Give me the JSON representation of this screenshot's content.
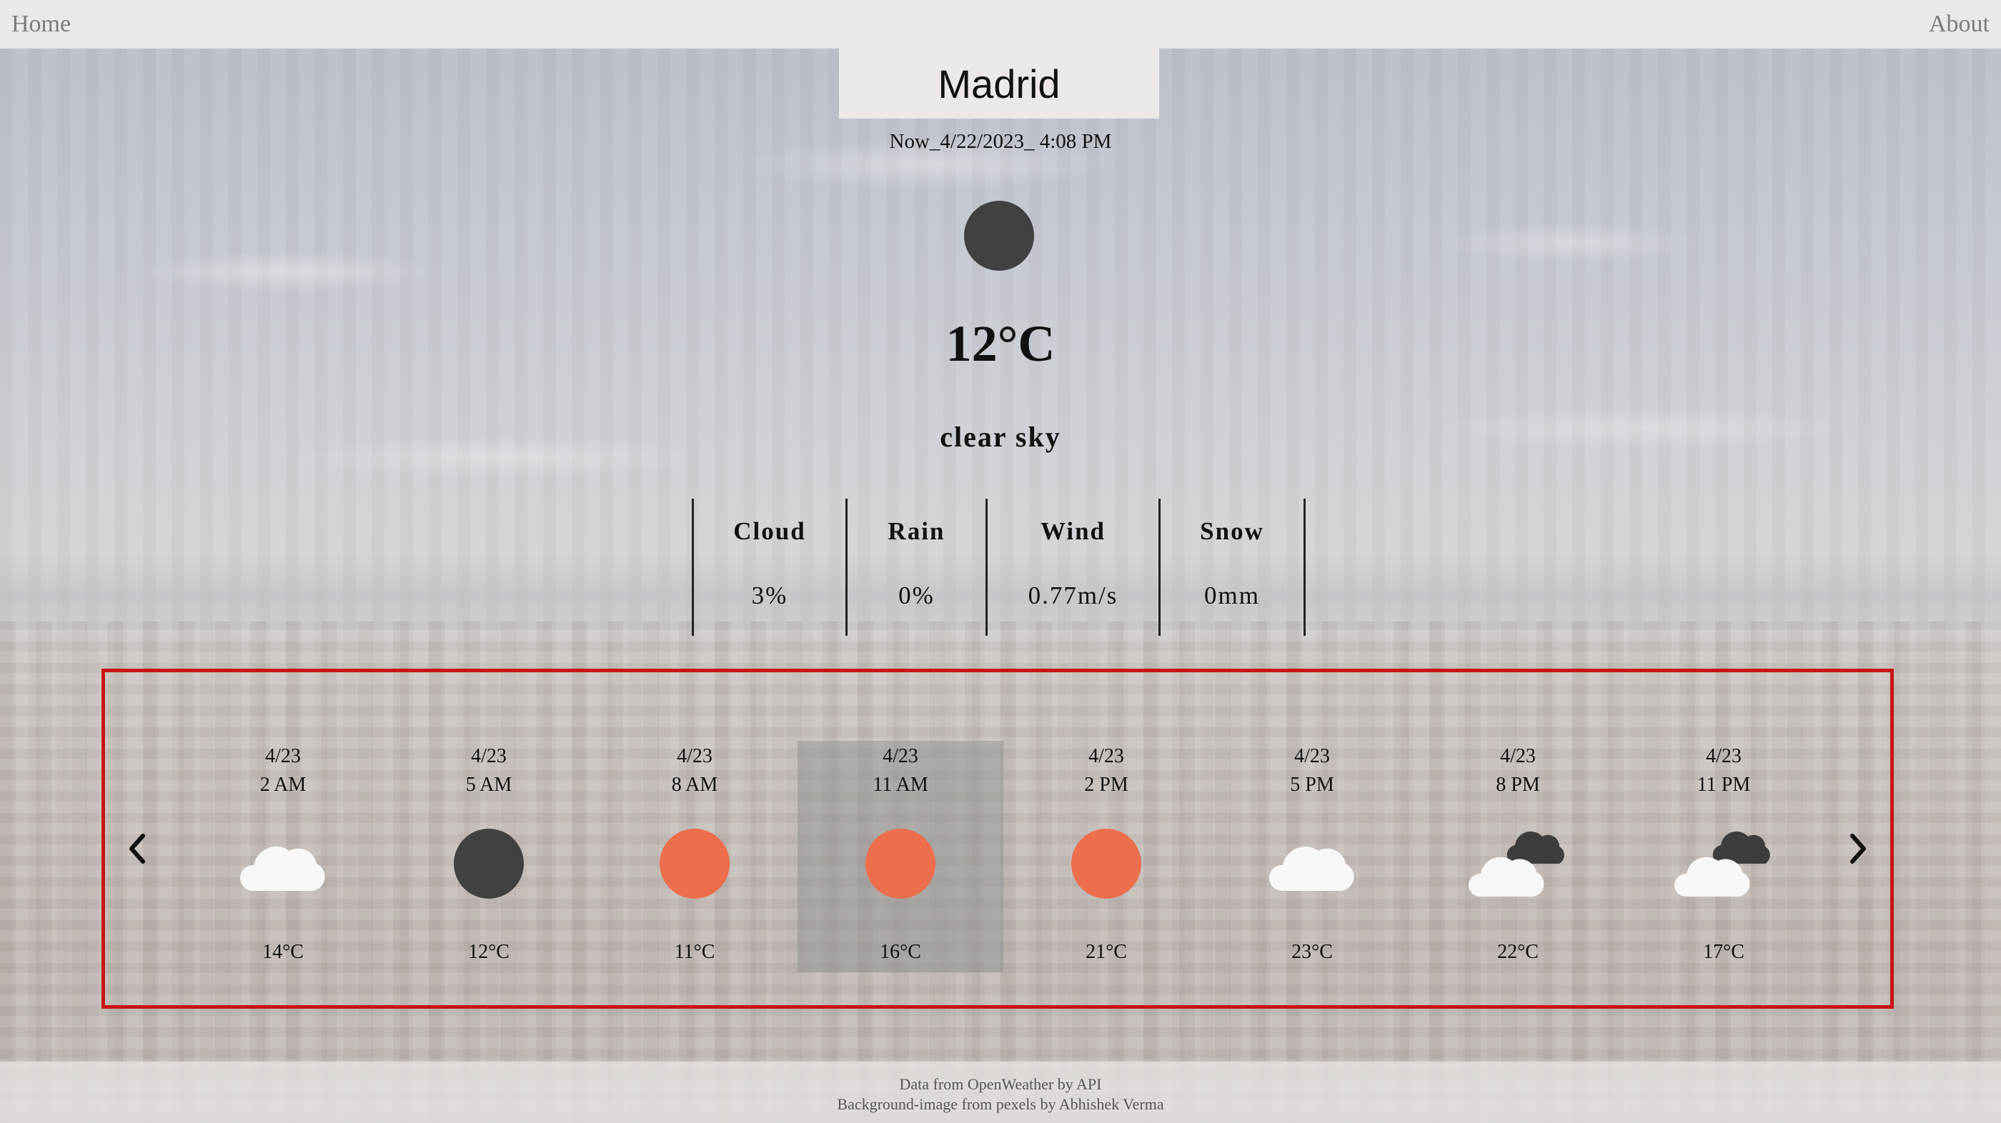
{
  "nav": {
    "home": "Home",
    "about": "About"
  },
  "current": {
    "city": "Madrid",
    "datetime": "Now_4/22/2023_ 4:08 PM",
    "icon": "moon-icon",
    "temperature": "12°C",
    "description": "clear sky"
  },
  "stats": [
    {
      "label": "Cloud",
      "value": "3%"
    },
    {
      "label": "Rain",
      "value": "0%"
    },
    {
      "label": "Wind",
      "value": "0.77m/s"
    },
    {
      "label": "Snow",
      "value": "0mm"
    }
  ],
  "forecast": [
    {
      "date": "4/23",
      "time": "2 AM",
      "icon": "cloud-icon",
      "temp": "14°C"
    },
    {
      "date": "4/23",
      "time": "5 AM",
      "icon": "moon-icon",
      "temp": "12°C"
    },
    {
      "date": "4/23",
      "time": "8 AM",
      "icon": "sun-icon",
      "temp": "11°C"
    },
    {
      "date": "4/23",
      "time": "11 AM",
      "icon": "sun-icon",
      "temp": "16°C"
    },
    {
      "date": "4/23",
      "time": "2 PM",
      "icon": "sun-icon",
      "temp": "21°C"
    },
    {
      "date": "4/23",
      "time": "5 PM",
      "icon": "cloud-icon",
      "temp": "23°C"
    },
    {
      "date": "4/23",
      "time": "8 PM",
      "icon": "dark-clouds-icon",
      "temp": "22°C"
    },
    {
      "date": "4/23",
      "time": "11 PM",
      "icon": "dark-clouds-icon",
      "temp": "17°C"
    }
  ],
  "footer": {
    "line1": "Data from OpenWeather by API",
    "line2": "Background-image from pexels by Abhishek Verma"
  },
  "colors": {
    "highlight_border": "#c81414",
    "sun": "#ed6e4d",
    "moon": "#414141"
  }
}
